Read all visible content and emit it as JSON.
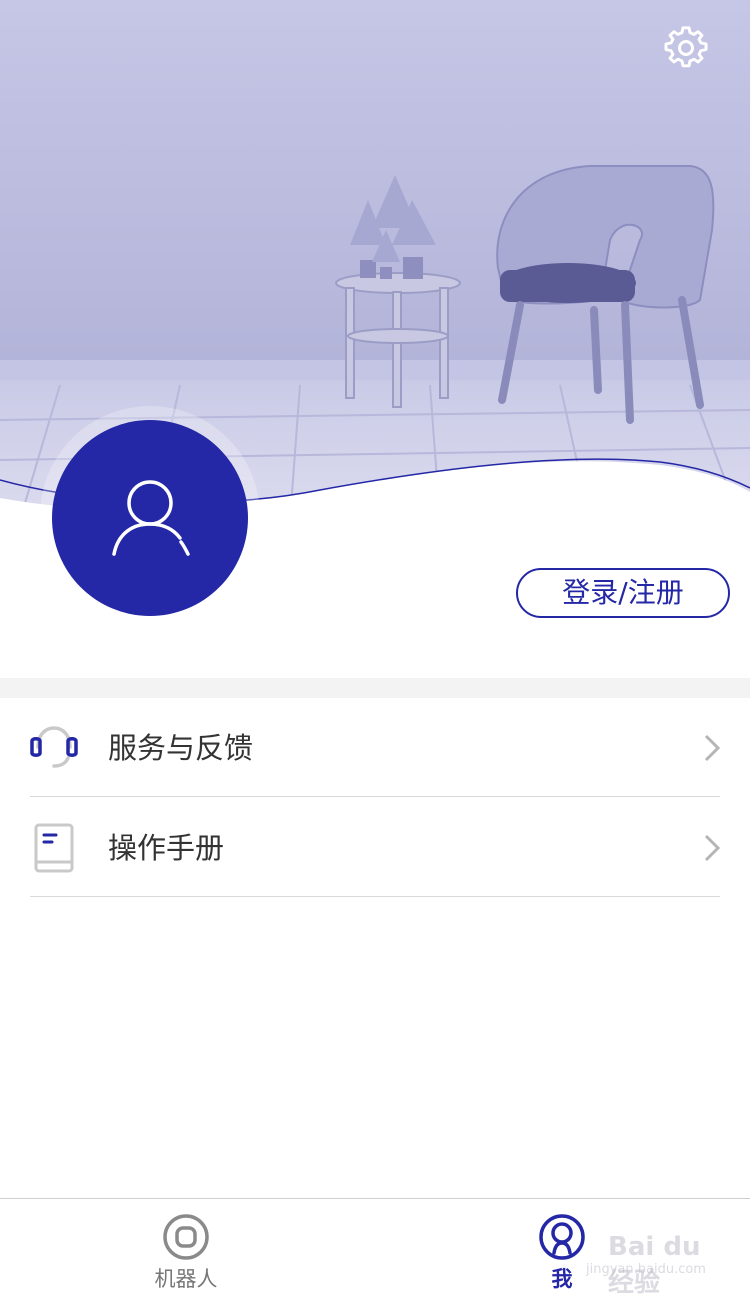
{
  "header": {
    "settings_icon": "gear-icon",
    "background": "room-with-chair-and-side-table"
  },
  "profile": {
    "avatar_icon": "user-icon",
    "login_label": "登录/注册"
  },
  "menu": [
    {
      "icon": "headset-icon",
      "label": "服务与反馈"
    },
    {
      "icon": "manual-book-icon",
      "label": "操作手册"
    }
  ],
  "tabbar": {
    "tabs": [
      {
        "icon": "robot-icon",
        "label": "机器人",
        "active": false
      },
      {
        "icon": "me-icon",
        "label": "我",
        "active": true
      }
    ]
  },
  "watermark": {
    "text": "Bai du 经验",
    "sub": "jingyan.baidu.com"
  },
  "colors": {
    "accent": "#2427a6",
    "hero_tint": "#c3c4e6",
    "divider": "#d9d9d9",
    "inactive_tab": "#777777"
  }
}
